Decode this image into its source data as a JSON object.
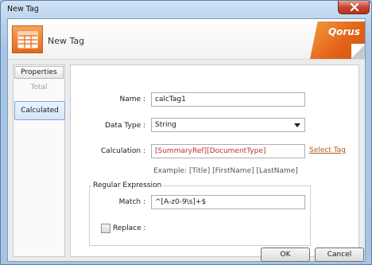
{
  "window": {
    "title": "New Tag"
  },
  "header": {
    "title": "New Tag",
    "brand": "Qorus"
  },
  "sidebar": {
    "header": "Properties",
    "items": [
      {
        "label": "Total"
      },
      {
        "label": "Calculated"
      }
    ]
  },
  "form": {
    "name_label": "Name :",
    "name_value": "calcTag1",
    "data_type_label": "Data Type :",
    "data_type_value": "String",
    "calculation_label": "Calculation :",
    "calculation_value": "[SummaryRef][DocumentType]",
    "select_tag_link": "Select Tag",
    "example_text": "Example: [Title] [FirstName] [LastName]",
    "regex_group_title": "Regular Expression",
    "match_label": "Match :",
    "match_value": "^[A-z0-9\\s]+$",
    "replace_label": "Replace :"
  },
  "footer": {
    "ok_label": "OK",
    "cancel_label": "Cancel"
  },
  "colors": {
    "accent_orange": "#e2621a",
    "selection_blue": "#d4e6f8",
    "calculation_red": "#c0302a"
  }
}
